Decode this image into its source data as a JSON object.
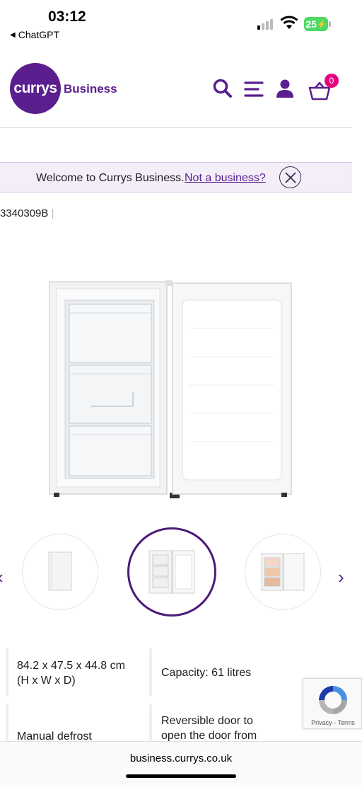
{
  "status_bar": {
    "time": "03:12",
    "back_app": "ChatGPT",
    "battery": "25"
  },
  "header": {
    "logo_text": "currys",
    "logo_suffix": "Business",
    "basket_count": "0",
    "icons": [
      "search-icon",
      "menu-icon",
      "account-icon",
      "basket-icon"
    ],
    "brand_color": "#5a1e8f",
    "badge_color": "#e6007e"
  },
  "welcome_banner": {
    "text": "Welcome to Currys Business.",
    "link": "Not a business?"
  },
  "product": {
    "sku": "3340309B"
  },
  "specs": [
    {
      "line1": "84.2 x 47.5 x 44.8 cm",
      "line2": "(H x W x D)"
    },
    {
      "line1": "Capacity: 61 litres",
      "line2": ""
    },
    {
      "line1": "Manual defrost",
      "line2": ""
    },
    {
      "line1": "Reversible door to",
      "line2": "open the door from"
    }
  ],
  "recaptcha": {
    "privacy": "Privacy",
    "separator": "-",
    "terms": "Terms"
  },
  "browser": {
    "url": "business.currys.co.uk"
  }
}
